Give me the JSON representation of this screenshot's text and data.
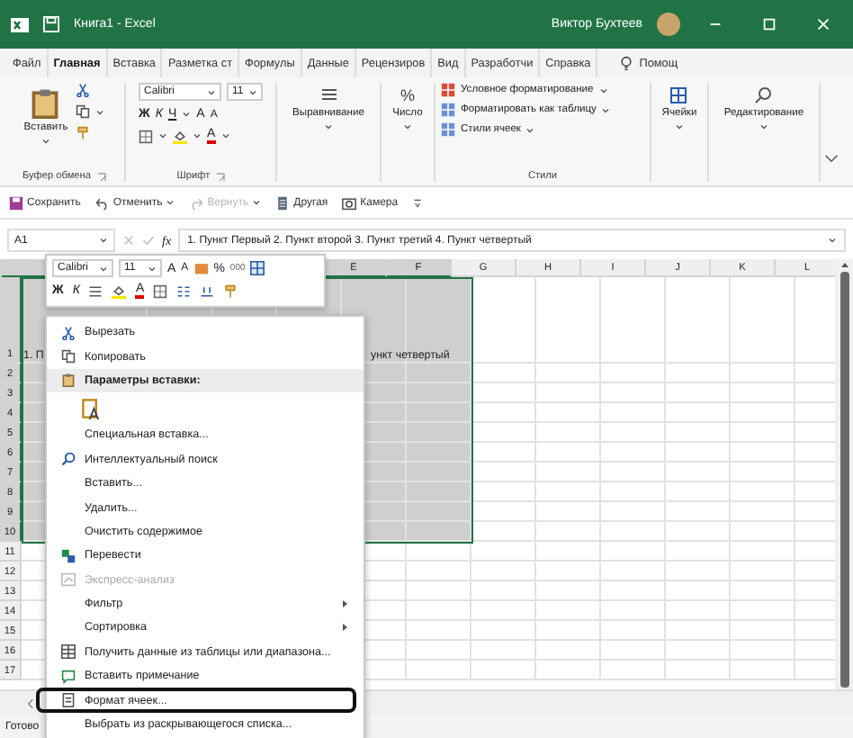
{
  "window": {
    "title": "Книга1 - Excel",
    "user": "Виктор Бухтеев"
  },
  "tabs": [
    {
      "label": "Файл",
      "selected": false
    },
    {
      "label": "Главная",
      "selected": true
    },
    {
      "label": "Вставка",
      "selected": false
    },
    {
      "label": "Разметка ст",
      "selected": false
    },
    {
      "label": "Формулы",
      "selected": false
    },
    {
      "label": "Данные",
      "selected": false
    },
    {
      "label": "Рецензиров",
      "selected": false
    },
    {
      "label": "Вид",
      "selected": false
    },
    {
      "label": "Разработчи",
      "selected": false
    },
    {
      "label": "Справка",
      "selected": false
    }
  ],
  "help": "Помощ",
  "ribbon": {
    "clipboard": {
      "label": "Буфер обмена",
      "paste": "Вставить"
    },
    "font": {
      "label": "Шрифт",
      "name": "Calibri",
      "size": "11",
      "bold": "Ж",
      "italic": "К",
      "underline": "Ч",
      "grow": "A",
      "shrink": "A",
      "font_color": "A"
    },
    "alignment": "Выравнивание",
    "number": {
      "label": "Число",
      "symbol": "%"
    },
    "styles": {
      "label": "Стили",
      "items": [
        "Условное форматирование",
        "Форматировать как таблицу",
        "Стили ячеек"
      ]
    },
    "cells": "Ячейки",
    "editing": "Редактирование"
  },
  "quick_access": [
    {
      "label": "Сохранить",
      "disabled": false,
      "dropdown": false
    },
    {
      "label": "Отменить",
      "disabled": false,
      "dropdown": true
    },
    {
      "label": "Вернуть",
      "disabled": true,
      "dropdown": true
    },
    {
      "label": "Другая",
      "disabled": false,
      "dropdown": false
    },
    {
      "label": "Камера",
      "disabled": false,
      "dropdown": false
    }
  ],
  "formula_bar": {
    "cell": "A1",
    "fx": "fx",
    "formula": "1. Пункт Первый 2. Пункт второй 3. Пункт третий 4. Пункт четвертый"
  },
  "columns": [
    {
      "label": "E",
      "selected": true
    },
    {
      "label": "F",
      "selected": true
    },
    {
      "label": "G",
      "selected": false
    },
    {
      "label": "H",
      "selected": false
    },
    {
      "label": "I",
      "selected": false
    },
    {
      "label": "J",
      "selected": false
    },
    {
      "label": "K",
      "selected": false
    },
    {
      "label": "L",
      "selected": false
    }
  ],
  "rows": [
    {
      "label": "1",
      "selected": true
    },
    {
      "label": "2",
      "selected": true
    },
    {
      "label": "3",
      "selected": true
    },
    {
      "label": "4",
      "selected": true
    },
    {
      "label": "5",
      "selected": true
    },
    {
      "label": "6",
      "selected": true
    },
    {
      "label": "7",
      "selected": true
    },
    {
      "label": "8",
      "selected": true
    },
    {
      "label": "9",
      "selected": true
    },
    {
      "label": "10",
      "selected": true
    },
    {
      "label": "11",
      "selected": false
    },
    {
      "label": "12",
      "selected": false
    },
    {
      "label": "13",
      "selected": false
    },
    {
      "label": "14",
      "selected": false
    },
    {
      "label": "15",
      "selected": false
    },
    {
      "label": "16",
      "selected": false
    },
    {
      "label": "17",
      "selected": false
    }
  ],
  "cell_text": {
    "left": "1. П",
    "right": "ункт четвертый"
  },
  "mini_toolbar": {
    "font": "Calibri",
    "size": "11",
    "grow": "A",
    "shrink": "A",
    "percent": "%",
    "thousands": "000",
    "bold": "Ж",
    "italic": "К",
    "font_color": "A"
  },
  "context_menu": [
    {
      "kind": "item",
      "label": "Вырезать",
      "disabled": false,
      "submenu": false,
      "highlighted": false
    },
    {
      "kind": "item",
      "label": "Копировать",
      "disabled": false,
      "submenu": false,
      "highlighted": false
    },
    {
      "kind": "header",
      "label": "Параметры вставки:"
    },
    {
      "kind": "paste-option"
    },
    {
      "kind": "item",
      "label": "Специальная вставка...",
      "disabled": false,
      "submenu": false,
      "highlighted": false
    },
    {
      "kind": "item",
      "label": "Интеллектуальный поиск",
      "disabled": false,
      "submenu": false,
      "highlighted": false
    },
    {
      "kind": "item",
      "label": "Вставить...",
      "disabled": false,
      "submenu": false,
      "highlighted": false
    },
    {
      "kind": "item",
      "label": "Удалить...",
      "disabled": false,
      "submenu": false,
      "highlighted": false
    },
    {
      "kind": "item",
      "label": "Очистить содержимое",
      "disabled": false,
      "submenu": false,
      "highlighted": false
    },
    {
      "kind": "item",
      "label": "Перевести",
      "disabled": false,
      "submenu": false,
      "highlighted": false
    },
    {
      "kind": "item",
      "label": "Экспресс-анализ",
      "disabled": true,
      "submenu": false,
      "highlighted": false
    },
    {
      "kind": "item",
      "label": "Фильтр",
      "disabled": false,
      "submenu": true,
      "highlighted": false
    },
    {
      "kind": "item",
      "label": "Сортировка",
      "disabled": false,
      "submenu": true,
      "highlighted": false
    },
    {
      "kind": "item",
      "label": "Получить данные из таблицы или диапазона...",
      "disabled": false,
      "submenu": false,
      "highlighted": false
    },
    {
      "kind": "item",
      "label": "Вставить примечание",
      "disabled": false,
      "submenu": false,
      "highlighted": false
    },
    {
      "kind": "item",
      "label": "Формат ячеек...",
      "disabled": false,
      "submenu": false,
      "highlighted": true
    },
    {
      "kind": "item",
      "label": "Выбрать из раскрывающегося списка...",
      "disabled": false,
      "submenu": false,
      "highlighted": false
    }
  ],
  "status_bar": {
    "text": "Готово"
  }
}
